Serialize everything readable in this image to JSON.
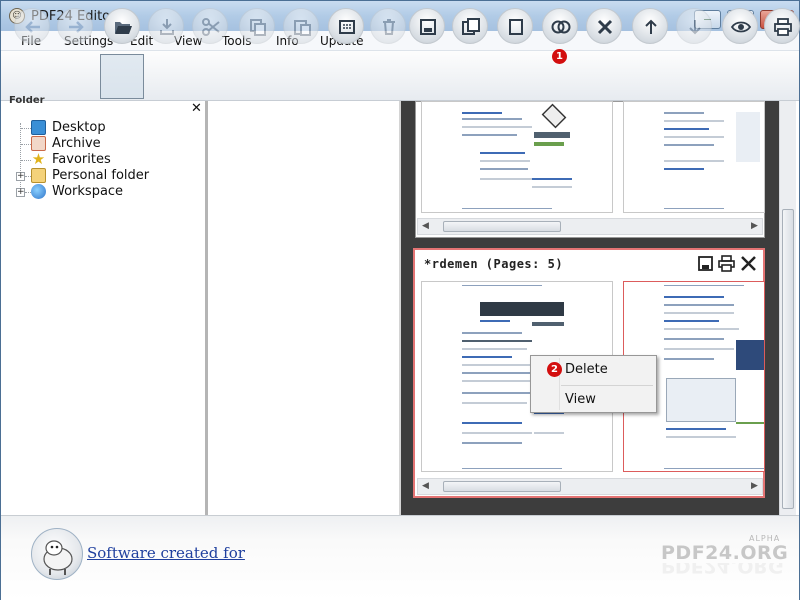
{
  "window": {
    "title": "PDF24 Editor",
    "controls": {
      "minimize": "−",
      "maximize": "□",
      "close": "✕"
    }
  },
  "menu": [
    "File",
    "Settings",
    "Edit",
    "View",
    "Tools",
    "Info",
    "Update"
  ],
  "toolbar": {
    "buttons": [
      {
        "icon": "back-arrow-icon",
        "enabled": false
      },
      {
        "icon": "forward-arrow-icon",
        "enabled": false
      },
      {
        "icon": "open-folder-icon",
        "enabled": true,
        "selected": true
      },
      {
        "icon": "import-icon",
        "enabled": false
      },
      {
        "icon": "scissors-icon",
        "enabled": false
      },
      {
        "icon": "copy-icon",
        "enabled": false
      },
      {
        "icon": "paste-icon",
        "enabled": false
      },
      {
        "icon": "select-all-icon",
        "enabled": true
      },
      {
        "icon": "trash-icon",
        "enabled": false
      },
      {
        "icon": "save-icon",
        "enabled": true
      },
      {
        "icon": "save-as-icon",
        "enabled": true
      },
      {
        "icon": "blank-page-icon",
        "enabled": true
      },
      {
        "icon": "merge-icon",
        "enabled": true,
        "badge": "1"
      },
      {
        "icon": "close-x-icon",
        "enabled": true
      },
      {
        "icon": "move-up-icon",
        "enabled": true
      },
      {
        "icon": "move-down-icon",
        "enabled": false
      },
      {
        "icon": "eye-icon",
        "enabled": true
      },
      {
        "icon": "print-icon",
        "enabled": true
      }
    ]
  },
  "folder_panel": {
    "header": "Folder",
    "close": "✕",
    "items": [
      {
        "label": "Desktop",
        "icon": "desktop-icon"
      },
      {
        "label": "Archive",
        "icon": "archive-icon"
      },
      {
        "label": "Favorites",
        "icon": "star-icon"
      },
      {
        "label": "Personal folder",
        "icon": "folder-icon",
        "expandable": true
      },
      {
        "label": "Workspace",
        "icon": "globe-icon",
        "expandable": true
      }
    ],
    "expander": "+"
  },
  "document": {
    "title": "*rdemen (Pages: 5)",
    "card_icons": [
      "save-icon",
      "print-icon",
      "close-icon"
    ]
  },
  "context_menu": {
    "badge": "2",
    "items": [
      "Delete",
      "View"
    ]
  },
  "footer": {
    "link": "Software created for",
    "brand_small": "ALPHA",
    "brand": "PDF24.ORG"
  },
  "colors": {
    "accent_red": "#d30e0e",
    "selected_card_border": "#e47474",
    "link_blue": "#1f3f9e"
  }
}
